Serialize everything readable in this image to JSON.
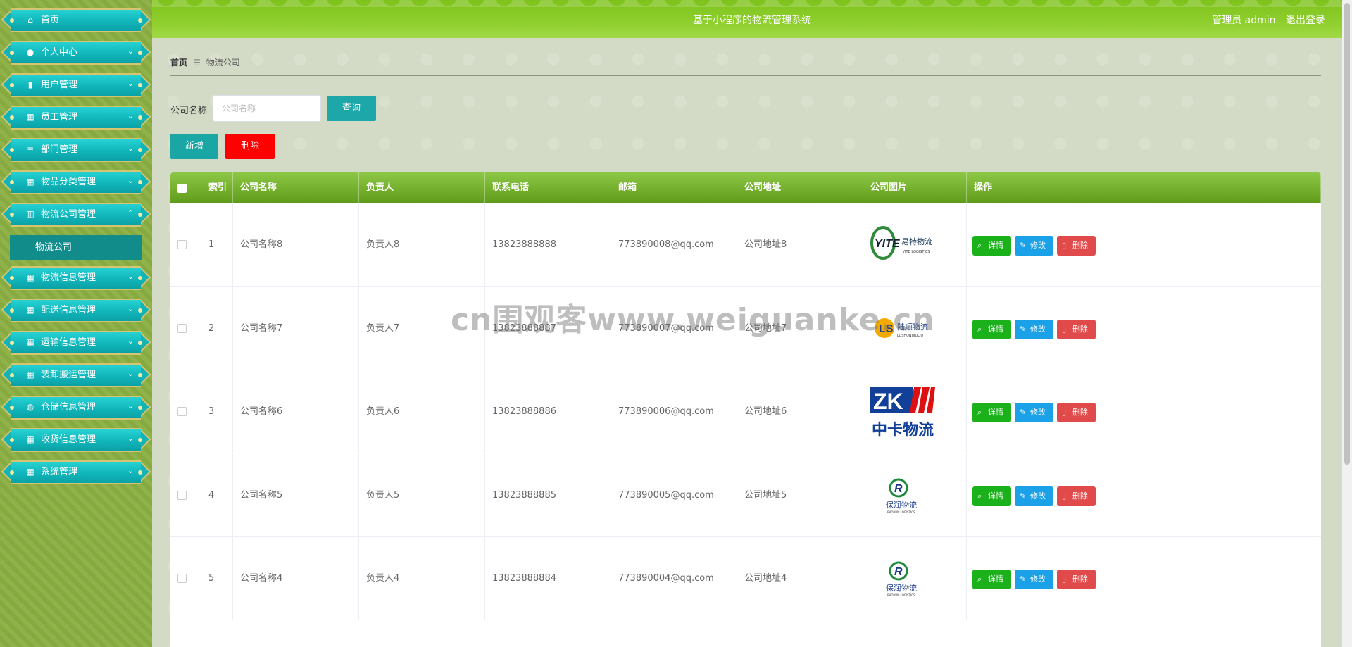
{
  "header": {
    "title": "基于小程序的物流管理系统",
    "user": "管理员 admin",
    "logout": "退出登录"
  },
  "sidebar": {
    "items": [
      {
        "label": "首页",
        "icon": "home-icon"
      },
      {
        "label": "个人中心",
        "icon": "user-icon"
      },
      {
        "label": "用户管理",
        "icon": "bar-chart-icon"
      },
      {
        "label": "员工管理",
        "icon": "grid-icon"
      },
      {
        "label": "部门管理",
        "icon": "list-icon"
      },
      {
        "label": "物品分类管理",
        "icon": "grid-icon"
      },
      {
        "label": "物流公司管理",
        "icon": "building-icon"
      },
      {
        "label": "物流信息管理",
        "icon": "grid-icon"
      },
      {
        "label": "配送信息管理",
        "icon": "grid-icon"
      },
      {
        "label": "运输信息管理",
        "icon": "grid-icon"
      },
      {
        "label": "装卸搬运管理",
        "icon": "grid-icon"
      },
      {
        "label": "仓储信息管理",
        "icon": "bulb-icon"
      },
      {
        "label": "收货信息管理",
        "icon": "grid-icon"
      },
      {
        "label": "系统管理",
        "icon": "grid-icon"
      }
    ],
    "submenu": "物流公司"
  },
  "breadcrumb": {
    "home": "首页",
    "sep": "☰",
    "current": "物流公司"
  },
  "search": {
    "label": "公司名称",
    "placeholder": "公司名称",
    "query_btn": "查询"
  },
  "actions": {
    "add": "新增",
    "delete": "删除"
  },
  "table": {
    "headers": [
      "索引",
      "公司名称",
      "负责人",
      "联系电话",
      "邮箱",
      "公司地址",
      "公司图片",
      "操作"
    ],
    "row_actions": {
      "detail": "详情",
      "edit": "修改",
      "delete": "删除"
    },
    "rows": [
      {
        "index": "1",
        "name": "公司名称8",
        "manager": "负责人8",
        "phone": "13823888888",
        "email": "773890008@qq.com",
        "address": "公司地址8",
        "logo": "YITE 易特物流"
      },
      {
        "index": "2",
        "name": "公司名称7",
        "manager": "负责人7",
        "phone": "13823888887",
        "email": "773890007@qq.com",
        "address": "公司地址7",
        "logo": "陆顺物流"
      },
      {
        "index": "3",
        "name": "公司名称6",
        "manager": "负责人6",
        "phone": "13823888886",
        "email": "773890006@qq.com",
        "address": "公司地址6",
        "logo": "ZK 中卡物流"
      },
      {
        "index": "4",
        "name": "公司名称5",
        "manager": "负责人5",
        "phone": "13823888885",
        "email": "773890005@qq.com",
        "address": "公司地址5",
        "logo": "保润物流"
      },
      {
        "index": "5",
        "name": "公司名称4",
        "manager": "负责人4",
        "phone": "13823888884",
        "email": "773890004@qq.com",
        "address": "公司地址4",
        "logo": "保润物流"
      }
    ]
  },
  "watermark": "cn围观客www.weiguanke.cn"
}
